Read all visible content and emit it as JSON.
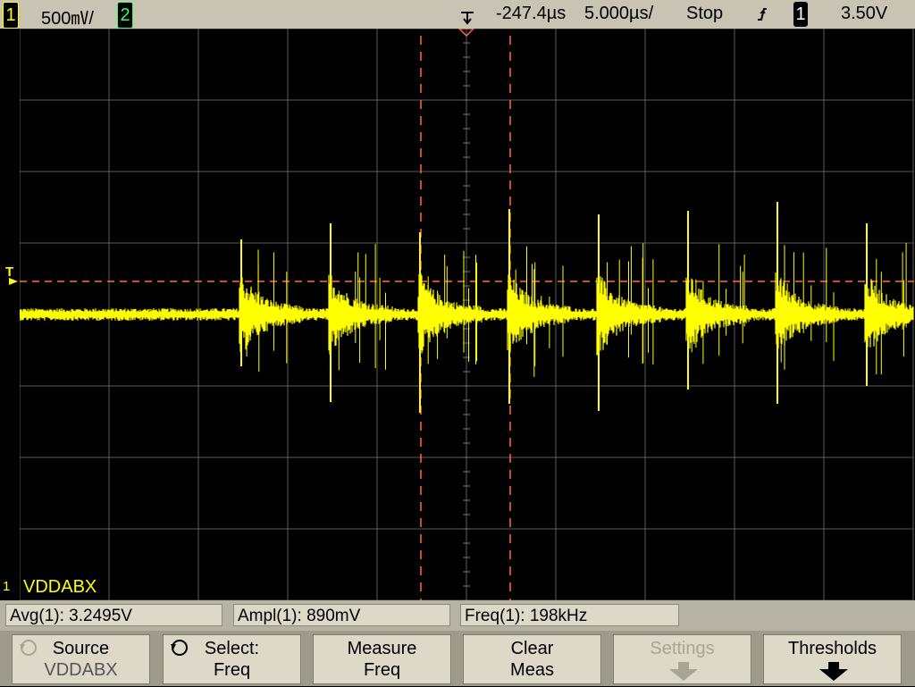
{
  "status_bar": {
    "channel1_label": "1",
    "channel1_scale": "500㎷/",
    "channel2_label": "2",
    "time_delay": "-247.4µs",
    "time_scale": "5.000µs/",
    "run_state": "Stop",
    "trigger_source": "1",
    "trigger_level": "3.50V"
  },
  "screen": {
    "trigger_marker": "T",
    "ground_marker": "1",
    "channel1_name": "VDDABX"
  },
  "measurements": [
    {
      "label": "Avg(1): 3.2495V"
    },
    {
      "label": "Ampl(1): 890mV"
    },
    {
      "label": "Freq(1): 198kHz"
    }
  ],
  "softkeys": [
    {
      "line1": "Source",
      "line2": "VDDABX",
      "icon": "rotate-knob-icon",
      "disabled": true
    },
    {
      "line1": "Select:",
      "line2": "Freq",
      "icon": "rotate-knob-icon",
      "disabled": false
    },
    {
      "line1": "Measure",
      "line2": "Freq",
      "disabled": false
    },
    {
      "line1": "Clear",
      "line2": "Meas",
      "disabled": false
    },
    {
      "line1": "Settings",
      "line2": "",
      "icon": "down-arrow-icon",
      "disabled": true
    },
    {
      "line1": "Thresholds",
      "line2": "",
      "icon": "down-arrow-icon",
      "disabled": false
    }
  ],
  "colors": {
    "trace": "#ffff00",
    "cursor": "#ff6a3d",
    "grid": "#5a5a5a"
  }
}
